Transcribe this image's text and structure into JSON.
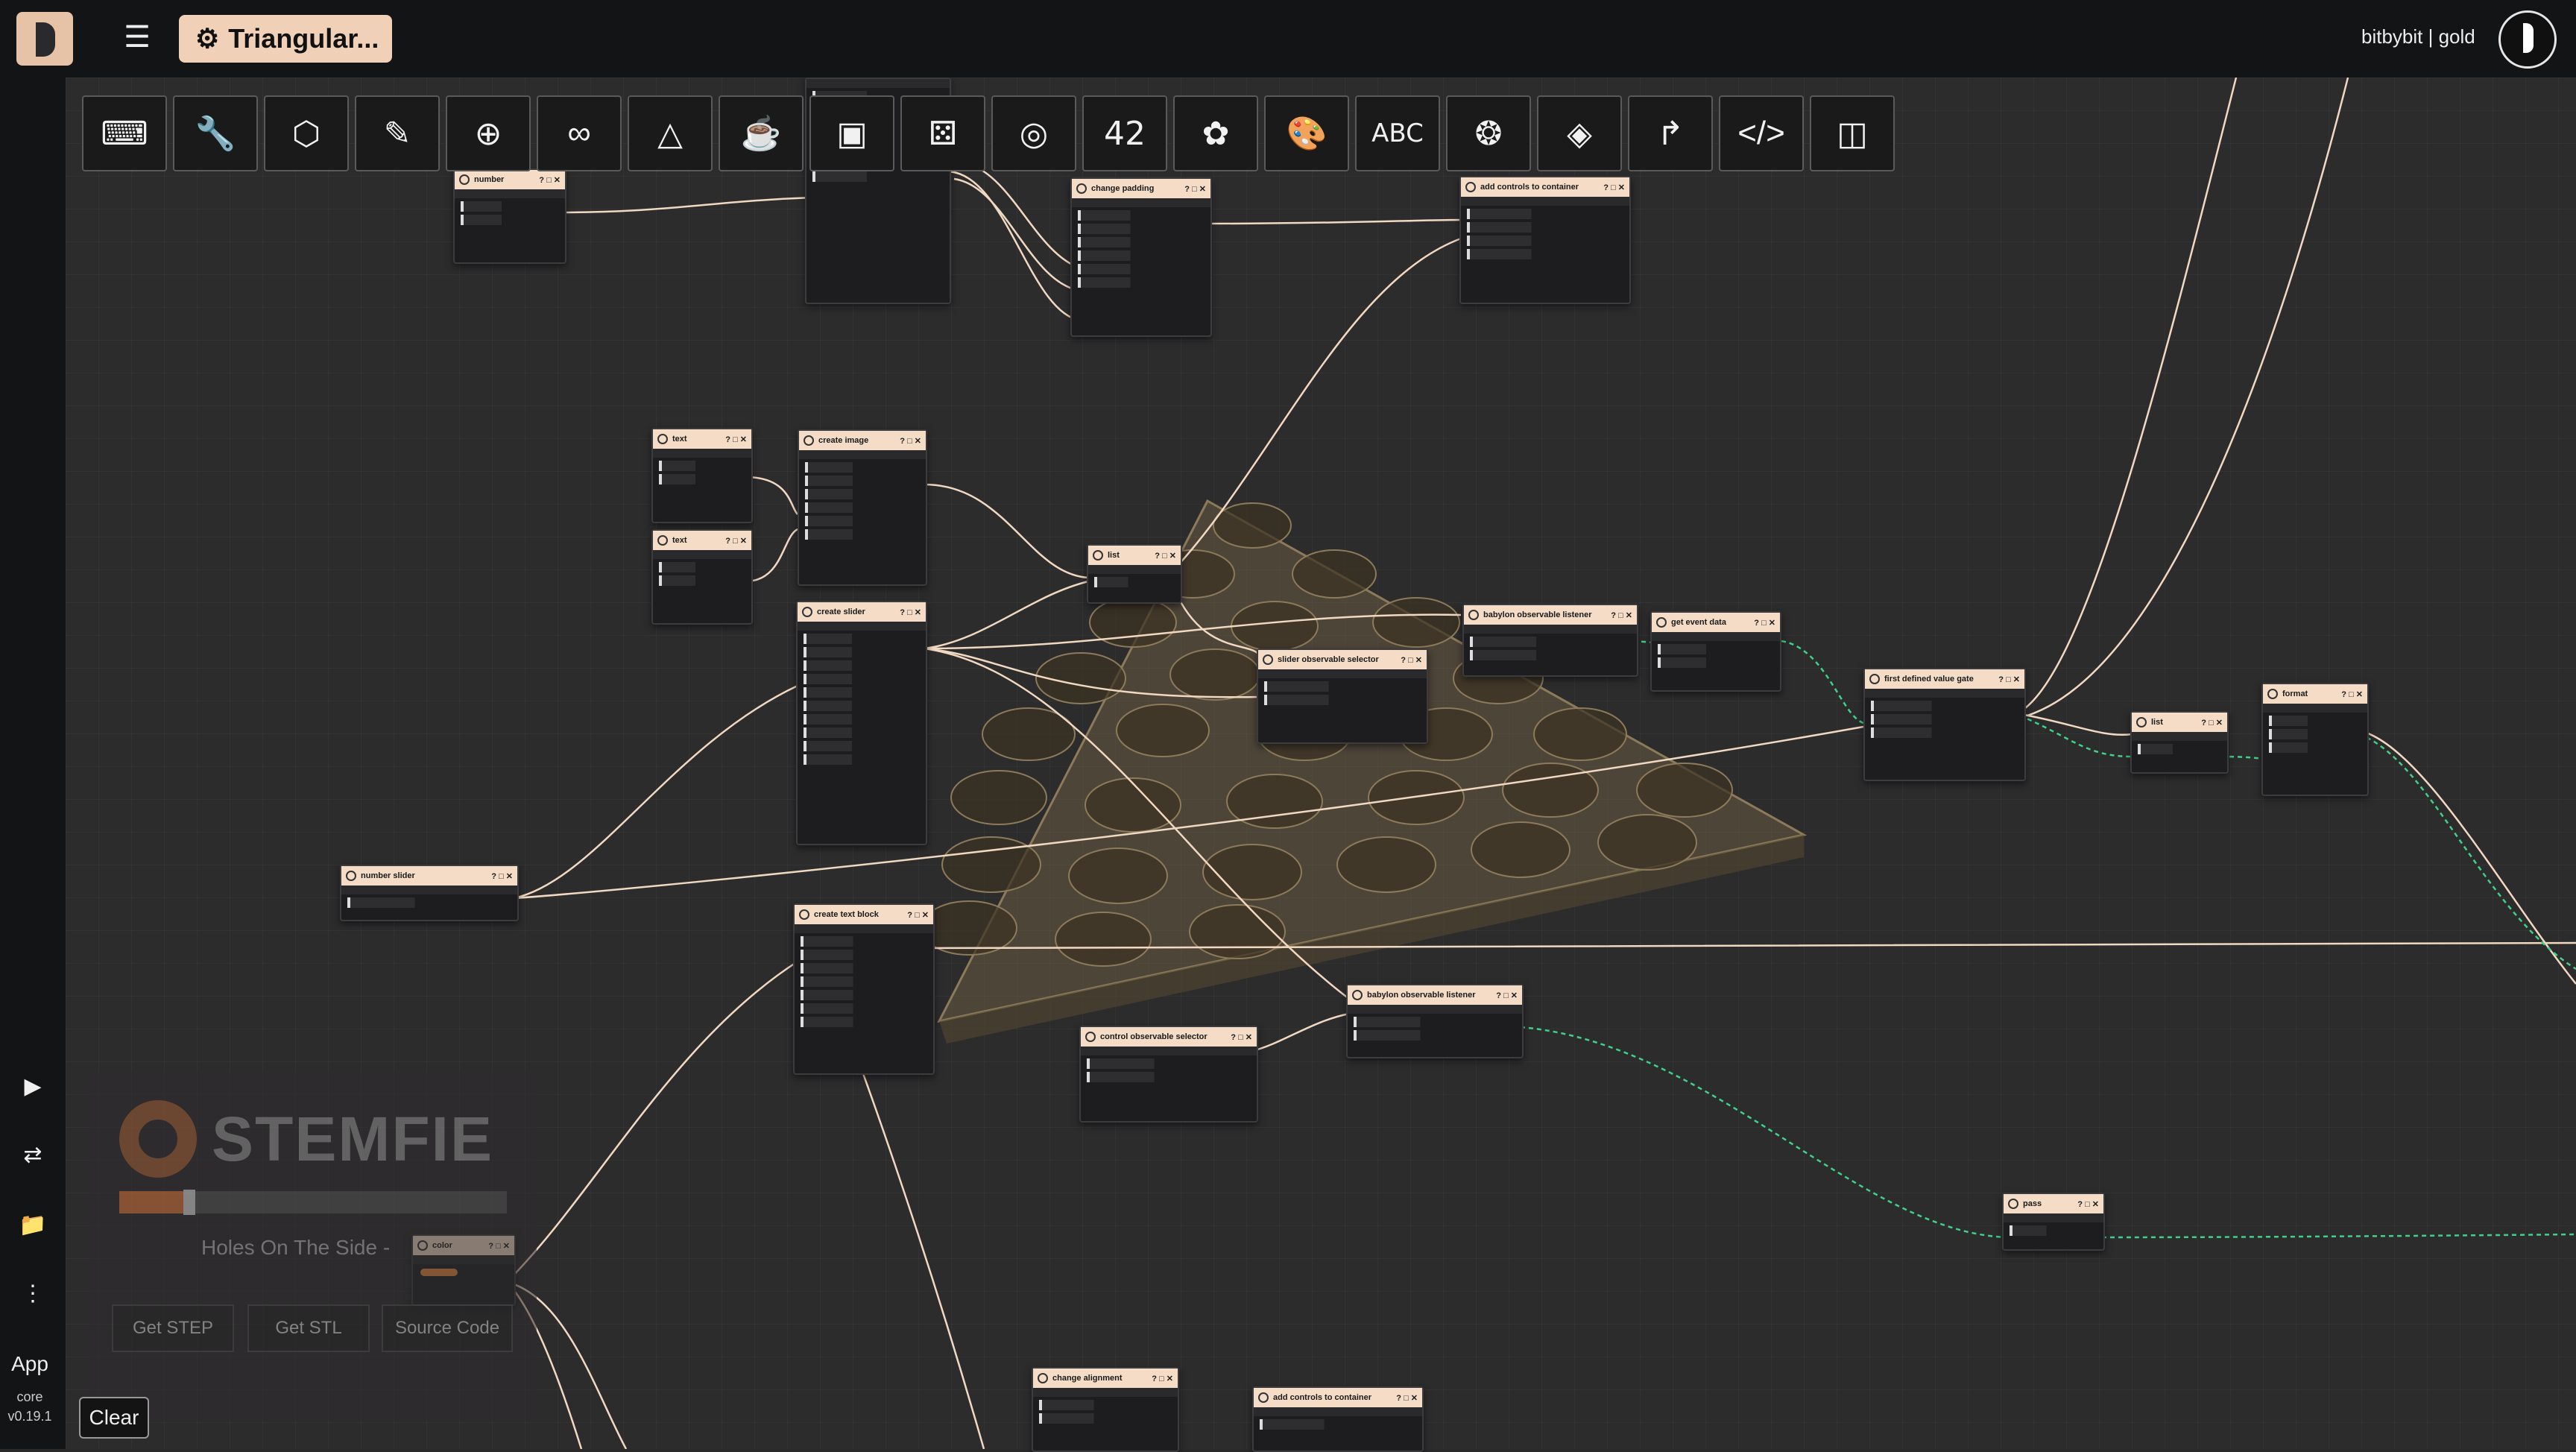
{
  "header": {
    "project_title": "Triangular...",
    "user_label": "bitbybit | gold"
  },
  "toolbar": [
    {
      "icon": "keyboard-icon"
    },
    {
      "icon": "wrench-icon"
    },
    {
      "icon": "hexagon-icon"
    },
    {
      "icon": "pipette-icon"
    },
    {
      "icon": "target-icon"
    },
    {
      "icon": "infinity-icon"
    },
    {
      "icon": "glasses-icon"
    },
    {
      "icon": "cup-icon"
    },
    {
      "icon": "cube-icon"
    },
    {
      "icon": "dice-icon"
    },
    {
      "icon": "rings-icon"
    },
    {
      "icon": "number-icon",
      "label": "42"
    },
    {
      "icon": "molecule-icon"
    },
    {
      "icon": "palette-icon"
    },
    {
      "icon": "text-icon",
      "label": "ABC"
    },
    {
      "icon": "spiral-icon"
    },
    {
      "icon": "tag-icon"
    },
    {
      "icon": "path-icon"
    },
    {
      "icon": "code-icon"
    },
    {
      "icon": "panel-icon"
    }
  ],
  "sidebar": {
    "app_label": "App",
    "core_label": "core",
    "version": "v0.19.1",
    "clear_label": "Clear"
  },
  "nodes": [
    {
      "title": "number"
    },
    {
      "title": "change padding"
    },
    {
      "title": "add controls to container"
    },
    {
      "title": "text"
    },
    {
      "title": "create image"
    },
    {
      "title": "text"
    },
    {
      "title": "create slider"
    },
    {
      "title": "list"
    },
    {
      "title": "slider observable selector"
    },
    {
      "title": "babylon observable listener"
    },
    {
      "title": "get event data"
    },
    {
      "title": "first defined value gate"
    },
    {
      "title": "list"
    },
    {
      "title": "format"
    },
    {
      "title": "number slider"
    },
    {
      "title": "create text block"
    },
    {
      "title": "babylon observable listener"
    },
    {
      "title": "control observable selector"
    },
    {
      "title": "pass"
    },
    {
      "title": "color"
    },
    {
      "title": "change alignment"
    },
    {
      "title": "add controls to container"
    }
  ],
  "preview": {
    "brand": "STEMFIE",
    "slider_value": 0.18,
    "slider_label": "Holes On The Side -",
    "buttons": [
      "Get STEP",
      "Get STL",
      "Source Code"
    ]
  }
}
